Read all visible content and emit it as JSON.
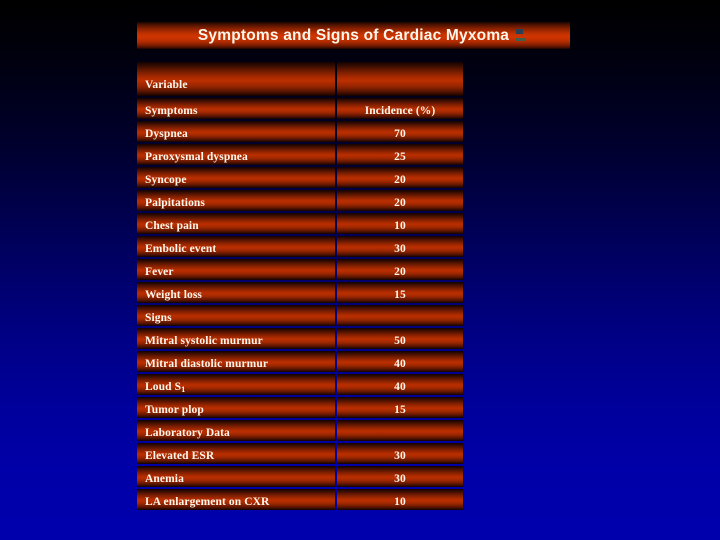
{
  "slide": {
    "title": "Symptoms and Signs of Cardiac Myxoma",
    "background_top_color": "#000000",
    "background_bottom_color": "#0000ad",
    "title_bar_color": "#c23200",
    "row_color": "#bb2f00",
    "text_color": "#fdf7ee",
    "separator_color": "#fdf6ec"
  },
  "table": {
    "columns": [
      "Variable",
      "Incidence (%)"
    ],
    "header_row": {
      "label": "Variable",
      "value": ""
    },
    "rows": [
      {
        "label": "Symptoms",
        "value": "Incidence (%)",
        "kind": "column-header"
      },
      {
        "label": "Dyspnea",
        "value": "70",
        "kind": "data"
      },
      {
        "label": "Paroxysmal dyspnea",
        "value": "25",
        "kind": "data"
      },
      {
        "label": "Syncope",
        "value": "20",
        "kind": "data"
      },
      {
        "label": "Palpitations",
        "value": "20",
        "kind": "data"
      },
      {
        "label": "Chest pain",
        "value": "10",
        "kind": "data"
      },
      {
        "label": "Embolic event",
        "value": "30",
        "kind": "data"
      },
      {
        "label": "Fever",
        "value": "20",
        "kind": "data"
      },
      {
        "label": "Weight loss",
        "value": "15",
        "kind": "data"
      },
      {
        "label": "Signs",
        "value": "",
        "kind": "section"
      },
      {
        "label": "Mitral systolic murmur",
        "value": "50",
        "kind": "data"
      },
      {
        "label": "Mitral diastolic murmur",
        "value": "40",
        "kind": "data"
      },
      {
        "label": "Loud S1",
        "label_html": "Loud S<sub>1</sub>",
        "value": "40",
        "kind": "data"
      },
      {
        "label": "Tumor plop",
        "value": "15",
        "kind": "data"
      },
      {
        "label": "Laboratory Data",
        "value": "",
        "kind": "section"
      },
      {
        "label": "Elevated ESR",
        "value": "30",
        "kind": "data"
      },
      {
        "label": "Anemia",
        "value": "30",
        "kind": "data"
      },
      {
        "label": "LA enlargement on CXR",
        "value": "10",
        "kind": "data"
      }
    ]
  }
}
